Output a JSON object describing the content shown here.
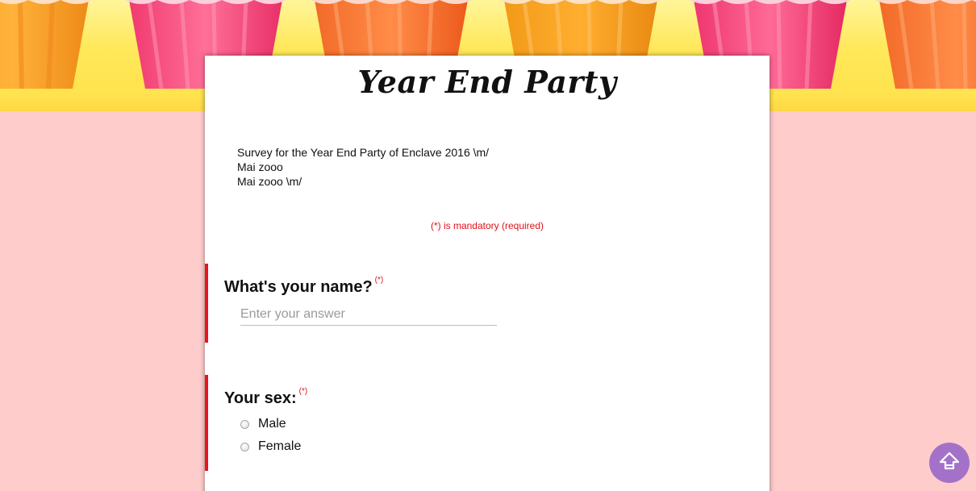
{
  "form": {
    "title": "Year End Party",
    "description_lines": [
      "Survey for the Year End Party of Enclave 2016 \\m/",
      "Mai zooo",
      "Mai zooo \\m/"
    ],
    "mandatory_note": "(*) is mandatory (required)",
    "required_marker": "(*)",
    "questions": [
      {
        "title": "What's your name?",
        "input_placeholder": "Enter your answer"
      },
      {
        "title": "Your sex:",
        "options": [
          "Male",
          "Female"
        ]
      }
    ]
  },
  "colors": {
    "page_background": "#ffcccc",
    "banner_yellow": "#ffe85a",
    "required_red": "#e8141c",
    "scroll_button": "#a372c8"
  },
  "icons": {
    "scroll_top": "arrow-up-icon"
  }
}
